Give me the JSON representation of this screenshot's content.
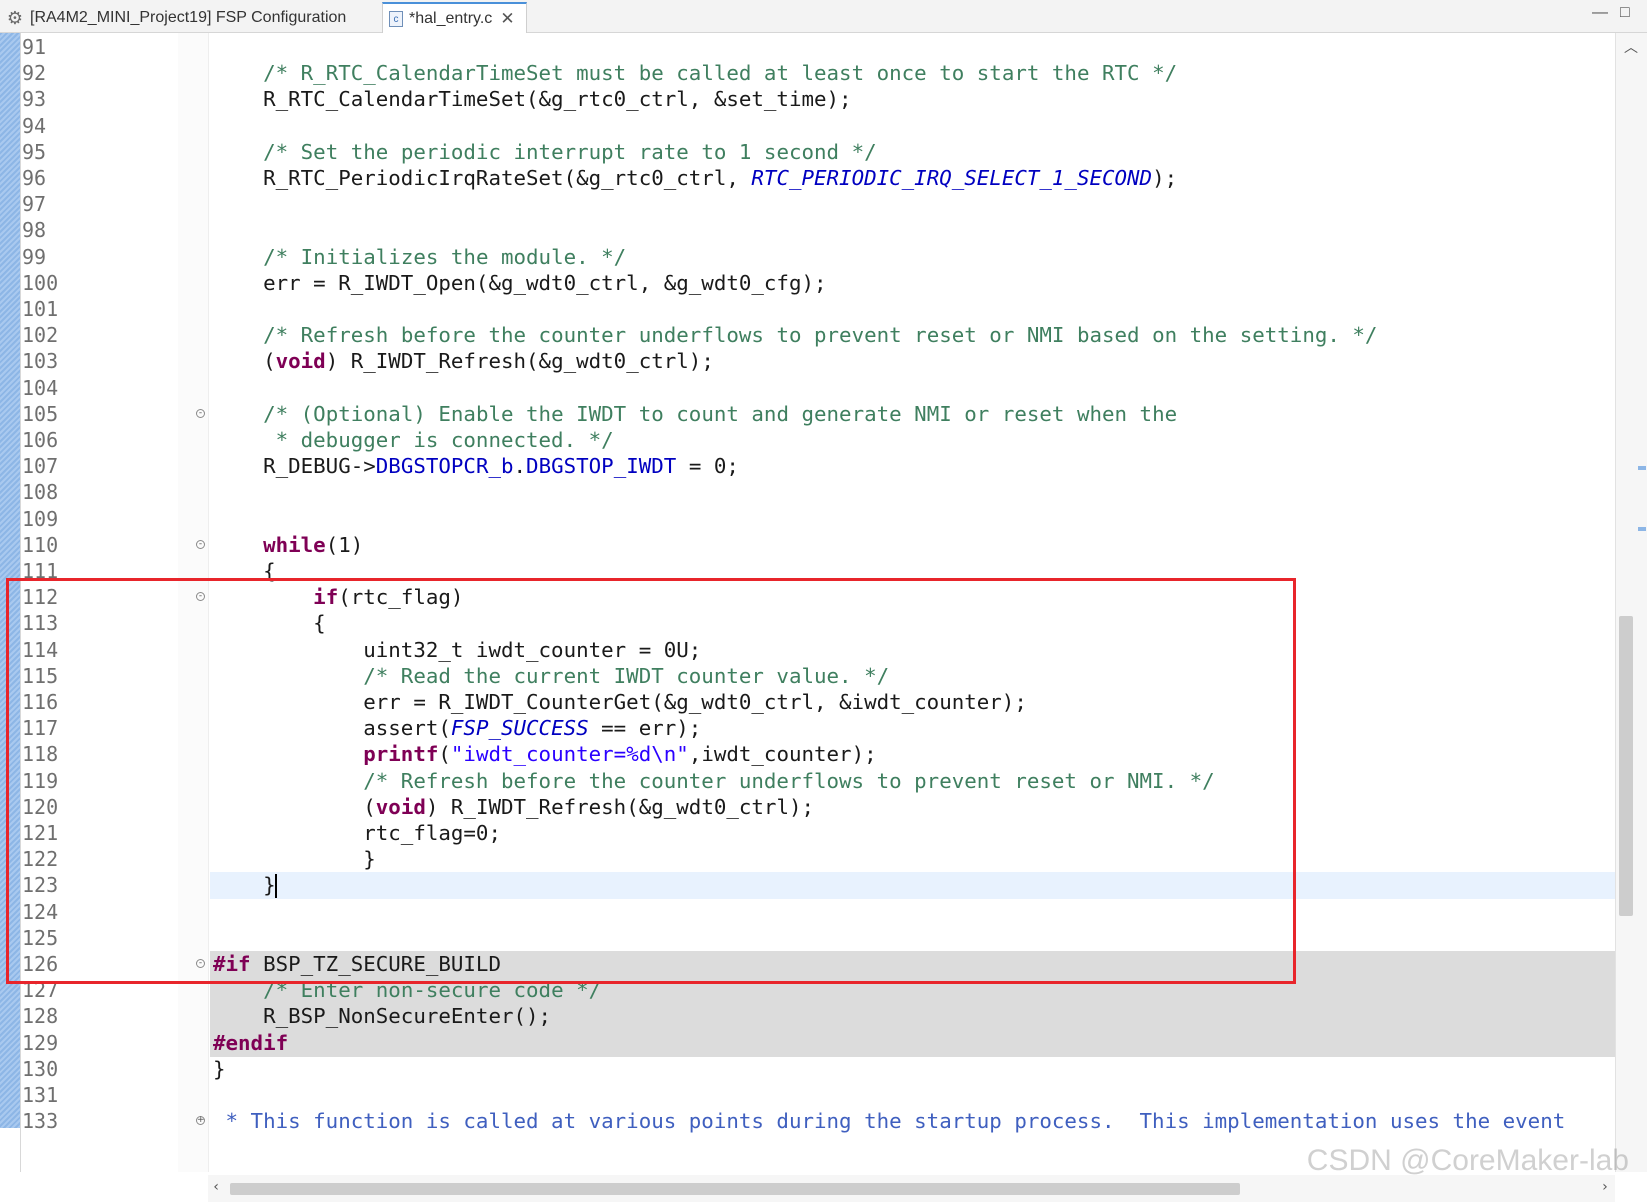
{
  "tabs": [
    {
      "label": "[RA4M2_MINI_Project19] FSP Configuration",
      "icon": "gear-icon",
      "active": false
    },
    {
      "label": "*hal_entry.c",
      "icon": "c-file-icon",
      "active": true
    }
  ],
  "window": {
    "minimize": "—",
    "maximize": "□"
  },
  "editor": {
    "lines": [
      {
        "n": "91",
        "html": ""
      },
      {
        "n": "92",
        "html": "    <span class='cm'>/* R_RTC_CalendarTimeSet must be called at least once to start the RTC */</span>"
      },
      {
        "n": "93",
        "html": "    R_RTC_CalendarTimeSet(&amp;g_rtc0_ctrl, &amp;set_time);"
      },
      {
        "n": "94",
        "html": ""
      },
      {
        "n": "95",
        "html": "    <span class='cm'>/* Set the periodic interrupt rate to 1 second */</span>"
      },
      {
        "n": "96",
        "html": "    R_RTC_PeriodicIrqRateSet(&amp;g_rtc0_ctrl, <span class='en'>RTC_PERIODIC_IRQ_SELECT_1_SECOND</span>);"
      },
      {
        "n": "97",
        "html": ""
      },
      {
        "n": "98",
        "html": ""
      },
      {
        "n": "99",
        "html": "    <span class='cm'>/* Initializes the module. */</span>"
      },
      {
        "n": "100",
        "html": "    err = R_IWDT_Open(&amp;g_wdt0_ctrl, &amp;g_wdt0_cfg);"
      },
      {
        "n": "101",
        "html": ""
      },
      {
        "n": "102",
        "html": "    <span class='cm'>/* Refresh before the counter underflows to prevent reset or NMI based on the setting. */</span>"
      },
      {
        "n": "103",
        "html": "    (<span class='kw'>void</span>) R_IWDT_Refresh(&amp;g_wdt0_ctrl);"
      },
      {
        "n": "104",
        "html": ""
      },
      {
        "n": "105",
        "html": "    <span class='cm'>/* (Optional) Enable the IWDT to count and generate NMI or reset when the</span>",
        "fold": "⊖"
      },
      {
        "n": "106",
        "html": "<span class='cm'>     * debugger is connected. */</span>"
      },
      {
        "n": "107",
        "html": "    R_DEBUG-&gt;<span class='fd'>DBGSTOPCR_b</span>.<span class='fd'>DBGSTOP_IWDT</span> = 0;"
      },
      {
        "n": "108",
        "html": ""
      },
      {
        "n": "109",
        "html": ""
      },
      {
        "n": "110",
        "html": "    <span class='kw'>while</span>(1)",
        "fold": "⊖"
      },
      {
        "n": "111",
        "html": "    {"
      },
      {
        "n": "112",
        "html": "        <span class='kw'>if</span>(rtc_flag)",
        "fold": "⊖"
      },
      {
        "n": "113",
        "html": "        {"
      },
      {
        "n": "114",
        "html": "            uint32_t iwdt_counter = 0U;"
      },
      {
        "n": "115",
        "html": "            <span class='cm'>/* Read the current IWDT counter value. */</span>"
      },
      {
        "n": "116",
        "html": "            err = R_IWDT_CounterGet(&amp;g_wdt0_ctrl, &amp;iwdt_counter);"
      },
      {
        "n": "117",
        "html": "            assert(<span class='en'>FSP_SUCCESS</span> == err);"
      },
      {
        "n": "118",
        "html": "            <span class='kw'>printf</span>(<span class='st'>\"iwdt_counter=%d\\n\"</span>,iwdt_counter);"
      },
      {
        "n": "119",
        "html": "            <span class='cm'>/* Refresh before the counter underflows to prevent reset or NMI. */</span>"
      },
      {
        "n": "120",
        "html": "            (<span class='kw'>void</span>) R_IWDT_Refresh(&amp;g_wdt0_ctrl);"
      },
      {
        "n": "121",
        "html": "            rtc_flag=0;"
      },
      {
        "n": "122",
        "html": "            }"
      },
      {
        "n": "123",
        "html": "    }<span class='caret'></span>",
        "current": true
      },
      {
        "n": "124",
        "html": ""
      },
      {
        "n": "125",
        "html": ""
      },
      {
        "n": "126",
        "html": "<span class='kw'>#if</span> BSP_TZ_SECURE_BUILD",
        "fold": "⊖",
        "ifdef": true
      },
      {
        "n": "127",
        "html": "    <span class='cm'>/* Enter non-secure code */</span>",
        "ifdef": true
      },
      {
        "n": "128",
        "html": "    R_BSP_NonSecureEnter();",
        "ifdef": true
      },
      {
        "n": "129",
        "html": "<span class='kw'>#endif</span>",
        "ifdef": true
      },
      {
        "n": "130",
        "html": "}"
      },
      {
        "n": "131",
        "html": ""
      },
      {
        "n": "133",
        "html": "<span class='jd'> * This function is called at various points during the startup process.  This implementation uses the event</span>",
        "fold": "⊕"
      }
    ]
  },
  "watermark": "CSDN @CoreMaker-lab"
}
